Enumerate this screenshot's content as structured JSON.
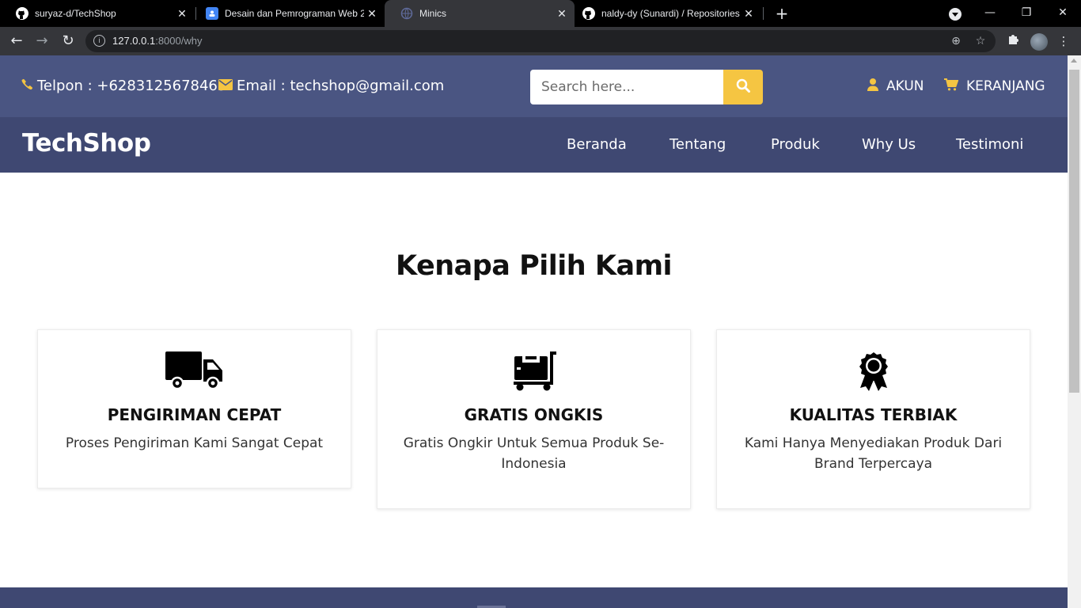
{
  "browser": {
    "tabs": [
      {
        "title": "suryaz-d/TechShop",
        "favicon": "github-icon"
      },
      {
        "title": "Desain dan Pemrograman Web 2",
        "favicon": "classroom-icon"
      },
      {
        "title": "Minics",
        "favicon": "loading-globe-icon"
      },
      {
        "title": "naldy-dy (Sunardi) / Repositories",
        "favicon": "github-icon"
      }
    ],
    "active_tab_index": 2,
    "url_host": "127.0.0.1",
    "url_path": ":8000/why"
  },
  "topbar": {
    "phone": "Telpon : +6283125678465",
    "email": "Email : techshop@gmail.com",
    "search_placeholder": "Search here...",
    "account": "AKUN",
    "cart": "KERANJANG"
  },
  "navbar": {
    "brand": "TechShop",
    "menu": [
      "Beranda",
      "Tentang",
      "Produk",
      "Why Us",
      "Testimoni"
    ]
  },
  "section": {
    "title": "Kenapa Pilih Kami",
    "cards": [
      {
        "icon": "truck-icon",
        "title": "PENGIRIMAN CEPAT",
        "desc": "Proses Pengiriman Kami Sangat Cepat"
      },
      {
        "icon": "cart-dolly-icon",
        "title": "GRATIS ONGKIS",
        "desc": "Gratis Ongkir Untuk Semua Produk Se-Indonesia"
      },
      {
        "icon": "award-badge-icon",
        "title": "KUALITAS TERBIAK",
        "desc": "Kami Hanya Menyediakan Produk Dari Brand Terpercaya"
      }
    ]
  },
  "colors": {
    "topbar_bg": "#4a5582",
    "navbar_bg": "#3f4872",
    "accent": "#f5c542"
  }
}
